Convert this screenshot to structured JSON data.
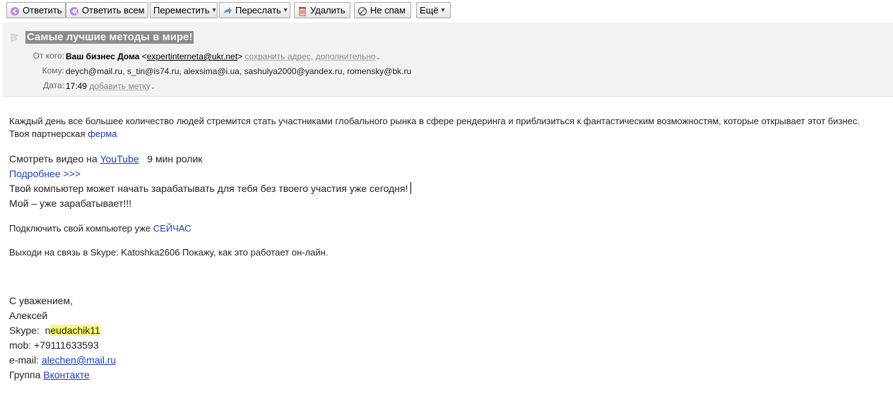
{
  "toolbar": {
    "reply": "Ответить",
    "reply_all": "Ответить всем",
    "move": "Переместить",
    "forward": "Переслать",
    "delete": "Удалить",
    "not_spam": "Не спам",
    "more": "Ещё"
  },
  "header": {
    "subject": "Самые лучшие методы в мире!",
    "from_label": "От кого:",
    "from_name": "Ваш бизнес Дома",
    "from_email": "expertinterneta@ukr.net",
    "save_address": "сохранить адрес",
    "more_info": "дополнительно",
    "to_label": "Кому:",
    "to_value": "deych@mail.ru, s_tin@is74.ru, alexsima@i.ua, sashulya2000@yandex.ru, romensky@bk.ru",
    "date_label": "Дата:",
    "date_value": "17:49",
    "add_tag": "добавить метку"
  },
  "body": {
    "p1": "Каждый день все большее количество людей стремится стать участниками глобального рынка в сфере рендеринга и приблизиться к фантастическим возможностям, которые открывает этот бизнес.",
    "p2_text": "Твоя партнерская ",
    "p2_link": "ферма",
    "video_text": "Смотреть видео на ",
    "video_link": "YouTube",
    "video_suffix": "   9 мин ролик",
    "more_link": "Подробнее >>>",
    "line_earn": "Твой компьютер может начать зарабатывать для тебя без твоего участия уже сегодня!",
    "line_mine": "Мой – уже зарабатывает!!!",
    "connect_text": "Подключить свой компьютер уже ",
    "connect_link": "СЕЙЧАС",
    "skype_line": "Выходи на связь в Skype: Katoshka2606  Покажу, как это работает он-лайн.",
    "regards": "С уважением,",
    "name": "Алексей",
    "skype_label": "Skype:  n",
    "skype_value": "eudachik11",
    "mob": "mob: +79111633593",
    "email_label": "e-mail: ",
    "email_link": "alechen@mail.ru",
    "group_label": "Группа ",
    "group_link": "Вконтакте"
  }
}
